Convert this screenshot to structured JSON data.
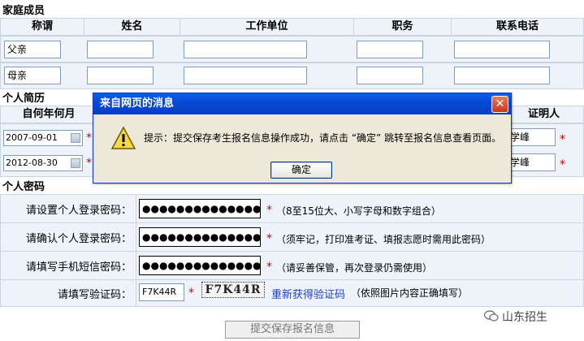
{
  "family": {
    "title": "家庭成员",
    "headers": [
      "称谓",
      "姓名",
      "工作单位",
      "职务",
      "联系电话"
    ],
    "rows": [
      {
        "relation": "父亲"
      },
      {
        "relation": "母亲"
      }
    ]
  },
  "resume": {
    "title": "个人简历",
    "header_from": "自何年何月",
    "header_witness": "证明人",
    "rows": [
      {
        "date": "2007-09-01",
        "witness": "学峰"
      },
      {
        "date": "2012-08-30",
        "witness": "学峰"
      }
    ]
  },
  "password": {
    "title": "个人密码",
    "set_label": "请设置个人登录密码：",
    "set_value": "●●●●●●●●●●●●●●●●●●●●",
    "set_hint": "（8至15位大、小写字母和数字组合）",
    "confirm_label": "请确认个人登录密码：",
    "confirm_value": "●●●●●●●●●●●●●●●●●●●●",
    "confirm_hint": "（须牢记，打印准考证、填报志愿时需用此密码）",
    "sms_label": "请填写手机短信密码：",
    "sms_value": "●●●●●●●●●●●●●●●●●●●●",
    "sms_hint": "（请妥善保管，再次登录仍需使用）",
    "captcha_label": "请填写验证码：",
    "captcha_value": "F7K44R",
    "captcha_image_text": "F7K44R",
    "captcha_refresh": "重新获得验证码",
    "captcha_hint": "（依照图片内容正确填写）",
    "required_mark": "*"
  },
  "dialog": {
    "title": "来自网页的消息",
    "message": "提示：提交保存考生报名信息操作成功，请点击 “确定” 跳转至报名信息查看页面。",
    "ok_label": "确定",
    "close_glyph": "✕",
    "icon": "warning-icon"
  },
  "submit_label": "提交保存报名信息",
  "watermark": "山东招生"
}
